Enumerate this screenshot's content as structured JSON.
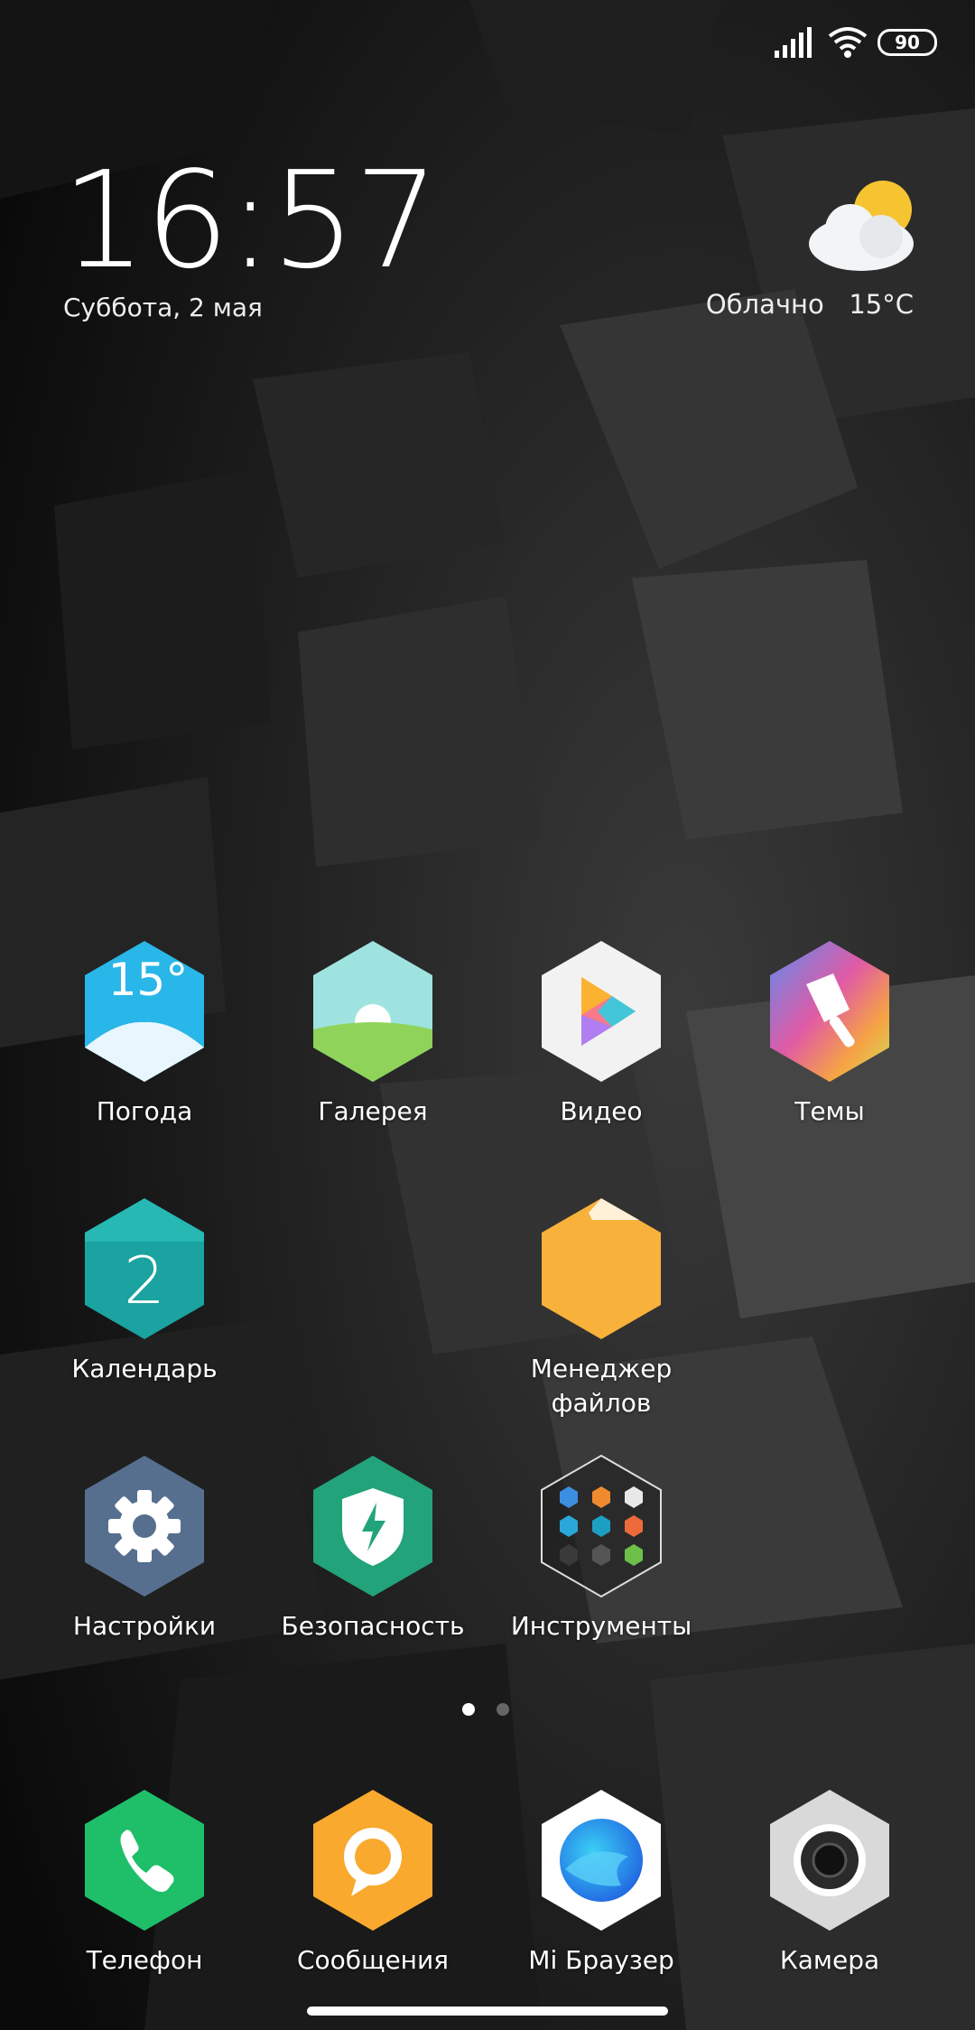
{
  "status_bar": {
    "battery": "90",
    "icons": [
      "signal-icon",
      "wifi-icon",
      "battery-icon"
    ]
  },
  "clock": {
    "time": "16:57",
    "date": "Суббота, 2 мая"
  },
  "weather_widget": {
    "condition": "Облачно",
    "temperature": "15°C",
    "icon": "partly-cloudy-icon"
  },
  "apps": [
    {
      "label": "Погода",
      "icon": "weather-app-icon",
      "color": "#29b6e8"
    },
    {
      "label": "Галерея",
      "icon": "gallery-icon",
      "color": "#8fd35a"
    },
    {
      "label": "Видео",
      "icon": "video-icon",
      "color": "#f2f2f2"
    },
    {
      "label": "Темы",
      "icon": "themes-icon",
      "color": "#e05aa5"
    },
    {
      "label": "Календарь",
      "icon": "calendar-icon",
      "color": "#1aa3a0"
    },
    {
      "label": "Менеджер\nфайлов",
      "icon": "file-manager-icon",
      "color": "#f8b13b"
    },
    {
      "label": "Настройки",
      "icon": "settings-icon",
      "color": "#566f8e"
    },
    {
      "label": "Безопасность",
      "icon": "security-icon",
      "color": "#22a37a"
    },
    {
      "label": "Инструменты",
      "icon": "tools-folder-icon",
      "color": "#222222"
    }
  ],
  "weather_app_temp": "15°",
  "calendar_day": "2",
  "page_indicator": {
    "pages": 2,
    "current": 1
  },
  "dock": [
    {
      "label": "Телефон",
      "icon": "phone-icon",
      "color": "#1fbf6a"
    },
    {
      "label": "Сообщения",
      "icon": "messages-icon",
      "color": "#f8a92e"
    },
    {
      "label": "Mi Браузер",
      "icon": "browser-icon",
      "color": "#2b8ff0"
    },
    {
      "label": "Камера",
      "icon": "camera-icon",
      "color": "#d9d9d9"
    }
  ]
}
